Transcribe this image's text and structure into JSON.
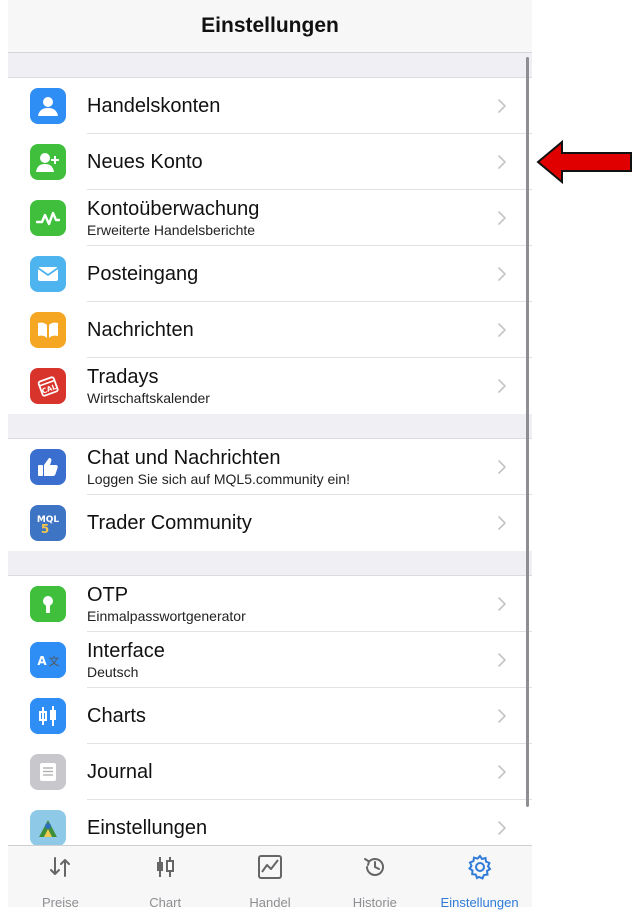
{
  "navbar": {
    "title": "Einstellungen"
  },
  "groups": [
    [
      {
        "label": "Handelskonten",
        "sub": "",
        "icon": "person-icon",
        "color": "#2f8ef5"
      },
      {
        "label": "Neues Konto",
        "sub": "",
        "icon": "add-person-icon",
        "color": "#3fbf3c"
      },
      {
        "label": "Kontoüberwachung",
        "sub": "Erweiterte Handelsberichte",
        "icon": "monitoring-chart-icon",
        "color": "#3fbf3c"
      },
      {
        "label": "Posteingang",
        "sub": "",
        "icon": "envelope-icon",
        "color": "#4eb4f0"
      },
      {
        "label": "Nachrichten",
        "sub": "",
        "icon": "book-icon",
        "color": "#f5a623"
      },
      {
        "label": "Tradays",
        "sub": "Wirtschaftskalender",
        "icon": "tradays-calendar-icon",
        "color": "#d9342b"
      }
    ],
    [
      {
        "label": "Chat und Nachrichten",
        "sub": "Loggen Sie sich auf MQL5.community ein!",
        "icon": "thumbs-up-icon",
        "color": "#3a6fd0"
      },
      {
        "label": "Trader Community",
        "sub": "",
        "icon": "mql5-icon",
        "color": "#3d74c4"
      }
    ],
    [
      {
        "label": "OTP",
        "sub": "Einmalpasswortgenerator",
        "icon": "keyhole-icon",
        "color": "#3fbf3c"
      },
      {
        "label": "Interface",
        "sub": "Deutsch",
        "icon": "language-icon",
        "color": "#2f8ef5"
      },
      {
        "label": "Charts",
        "sub": "",
        "icon": "candlestick-icon",
        "color": "#2f8ef5"
      },
      {
        "label": "Journal",
        "sub": "",
        "icon": "journal-icon",
        "color": "#c8c8cc"
      },
      {
        "label": "Einstellungen",
        "sub": "",
        "icon": "metatrader-icon",
        "color": "#8fc9e8"
      }
    ]
  ],
  "tabs": [
    {
      "label": "Preise",
      "icon": "quotes-arrows-icon",
      "active": false
    },
    {
      "label": "Chart",
      "icon": "candles-icon",
      "active": false
    },
    {
      "label": "Handel",
      "icon": "trade-chart-icon",
      "active": false
    },
    {
      "label": "Historie",
      "icon": "history-clock-icon",
      "active": false
    },
    {
      "label": "Einstellungen",
      "icon": "settings-gear-icon",
      "active": true
    }
  ],
  "colors": {
    "accent": "#2f7bd8",
    "annotation_arrow": "#e00000"
  }
}
